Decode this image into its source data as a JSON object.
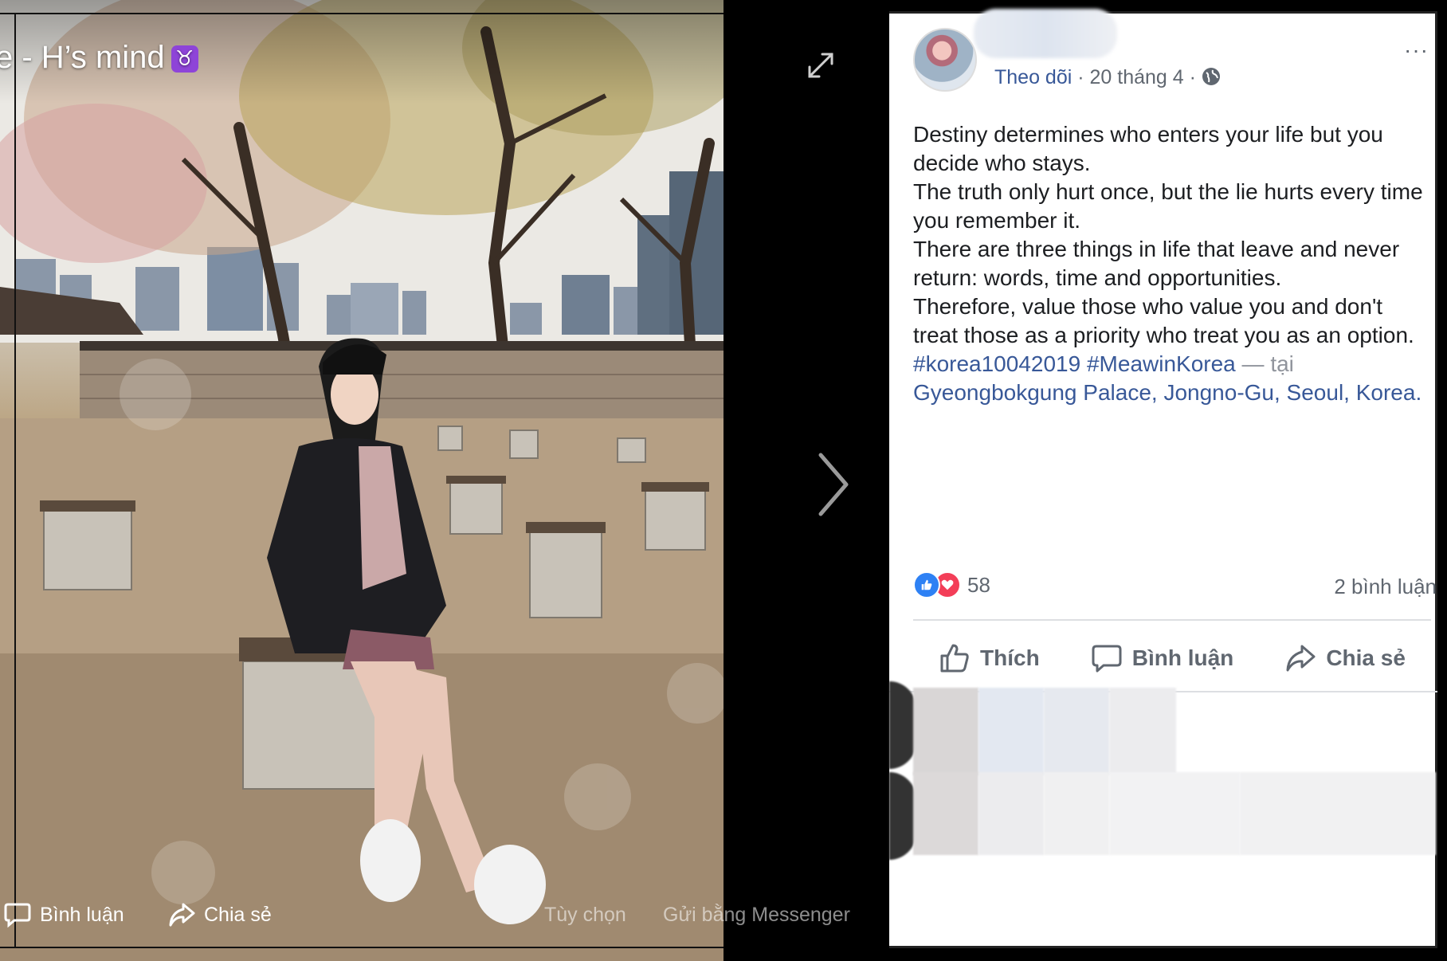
{
  "viewer": {
    "album_title": "e - H’s mind",
    "album_symbol": "♉",
    "bottom_bar": {
      "comment_label": "Bình luận",
      "share_label": "Chia sẻ",
      "options_label": "Tùy chọn",
      "messenger_label": "Gửi bằng Messenger"
    },
    "icons": {
      "expand": "expand-icon",
      "next": "chevron-right-icon"
    }
  },
  "post": {
    "follow_label": "Theo dõi",
    "separator": " · ",
    "date": "20 tháng 4",
    "privacy_icon": "globe-icon",
    "more_icon": "···",
    "text_lines": [
      "Destiny determines who enters your life but you decide who stays.",
      "The truth only hurt once, but the lie hurts every time you remember it.",
      "There are three things in life that leave and never return: words, time and opportunities.",
      "Therefore, value those who value you and don't treat those as a priority who treat you as an option."
    ],
    "hashtags": [
      "#korea10042019",
      "#MeawinKorea"
    ],
    "at_label": "— tại",
    "place": "Gyeongbokgung Palace, Jongno-Gu, Seoul, Korea.",
    "reaction_count": "58",
    "comment_count_label": "2 bình luận",
    "actions": {
      "like": "Thích",
      "comment": "Bình luận",
      "share": "Chia sẻ"
    }
  },
  "colors": {
    "link_blue": "#385898",
    "like_blue": "#2e81f4",
    "love_red": "#f33e58",
    "text_dark": "#1c1e21",
    "text_muted": "#606770"
  }
}
